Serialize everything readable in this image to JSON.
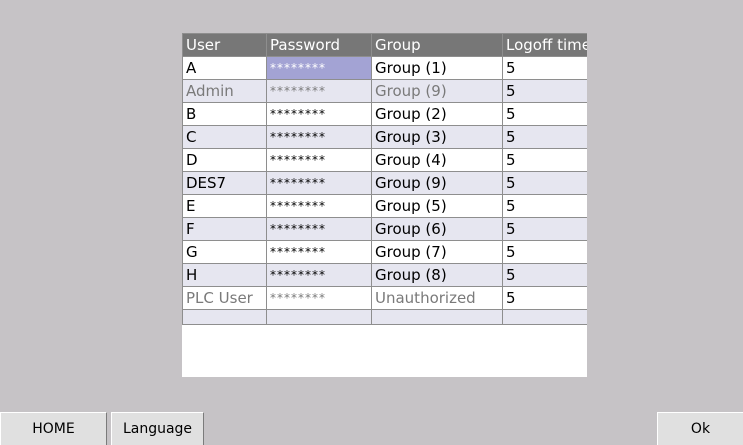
{
  "table": {
    "headers": [
      "User",
      "Password",
      "Group",
      "Logoff time"
    ],
    "rows": [
      {
        "user": "A",
        "password": "********",
        "group": "Group (1)",
        "logoff": "5"
      },
      {
        "user": "Admin",
        "password": "********",
        "group": "Group (9)",
        "logoff": "5"
      },
      {
        "user": "B",
        "password": "********",
        "group": "Group (2)",
        "logoff": "5"
      },
      {
        "user": "C",
        "password": "********",
        "group": "Group (3)",
        "logoff": "5"
      },
      {
        "user": "D",
        "password": "********",
        "group": "Group (4)",
        "logoff": "5"
      },
      {
        "user": "DES7",
        "password": "********",
        "group": "Group (9)",
        "logoff": "5"
      },
      {
        "user": "E",
        "password": "********",
        "group": "Group (5)",
        "logoff": "5"
      },
      {
        "user": "F",
        "password": "********",
        "group": "Group (6)",
        "logoff": "5"
      },
      {
        "user": "G",
        "password": "********",
        "group": "Group (7)",
        "logoff": "5"
      },
      {
        "user": "H",
        "password": "********",
        "group": "Group (8)",
        "logoff": "5"
      },
      {
        "user": "PLC User",
        "password": "********",
        "group": "Unauthorized",
        "logoff": "5"
      }
    ]
  },
  "buttons": {
    "home": "HOME",
    "language": "Language",
    "ok": "Ok"
  },
  "colors": {
    "background": "#c6c3c6",
    "header": "#777777",
    "row_alt": "#e6e6f0",
    "selection": "#a3a3d4"
  }
}
